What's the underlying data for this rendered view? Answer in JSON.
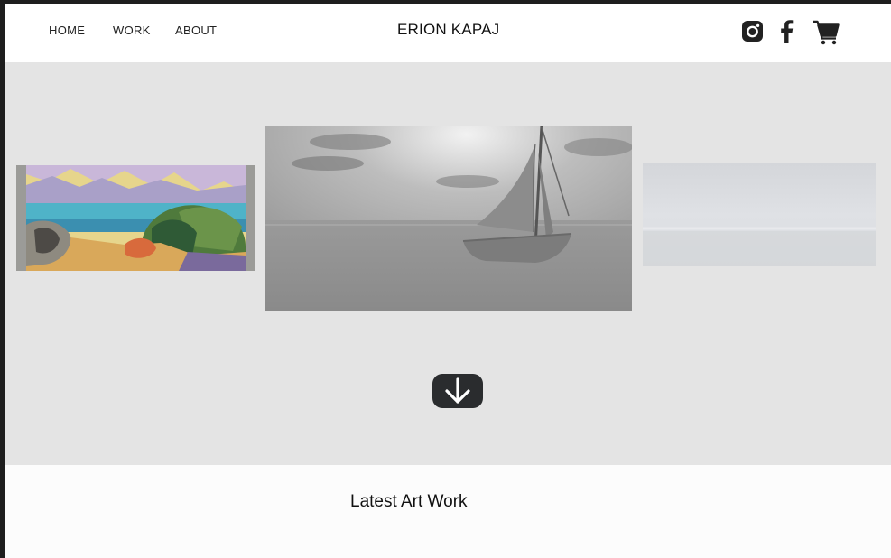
{
  "nav": {
    "items": [
      {
        "label": "HOME"
      },
      {
        "label": "WORK"
      },
      {
        "label": "ABOUT"
      }
    ]
  },
  "brand": {
    "name": "ERION KAPAJ"
  },
  "header_icons": [
    "instagram-icon",
    "facebook-icon",
    "shopping-cart-icon"
  ],
  "hero": {
    "artworks": [
      {
        "subject": "colorful-landscape-painting"
      },
      {
        "subject": "sailboat-painting"
      },
      {
        "subject": "misty-seascape-painting"
      }
    ],
    "scroll_icon": "arrow-down-icon"
  },
  "latest": {
    "title": "Latest Art Work"
  },
  "colors": {
    "hero_bg": "#e4e4e4",
    "scroll_button": "#2a2c2e",
    "text": "#111111"
  }
}
